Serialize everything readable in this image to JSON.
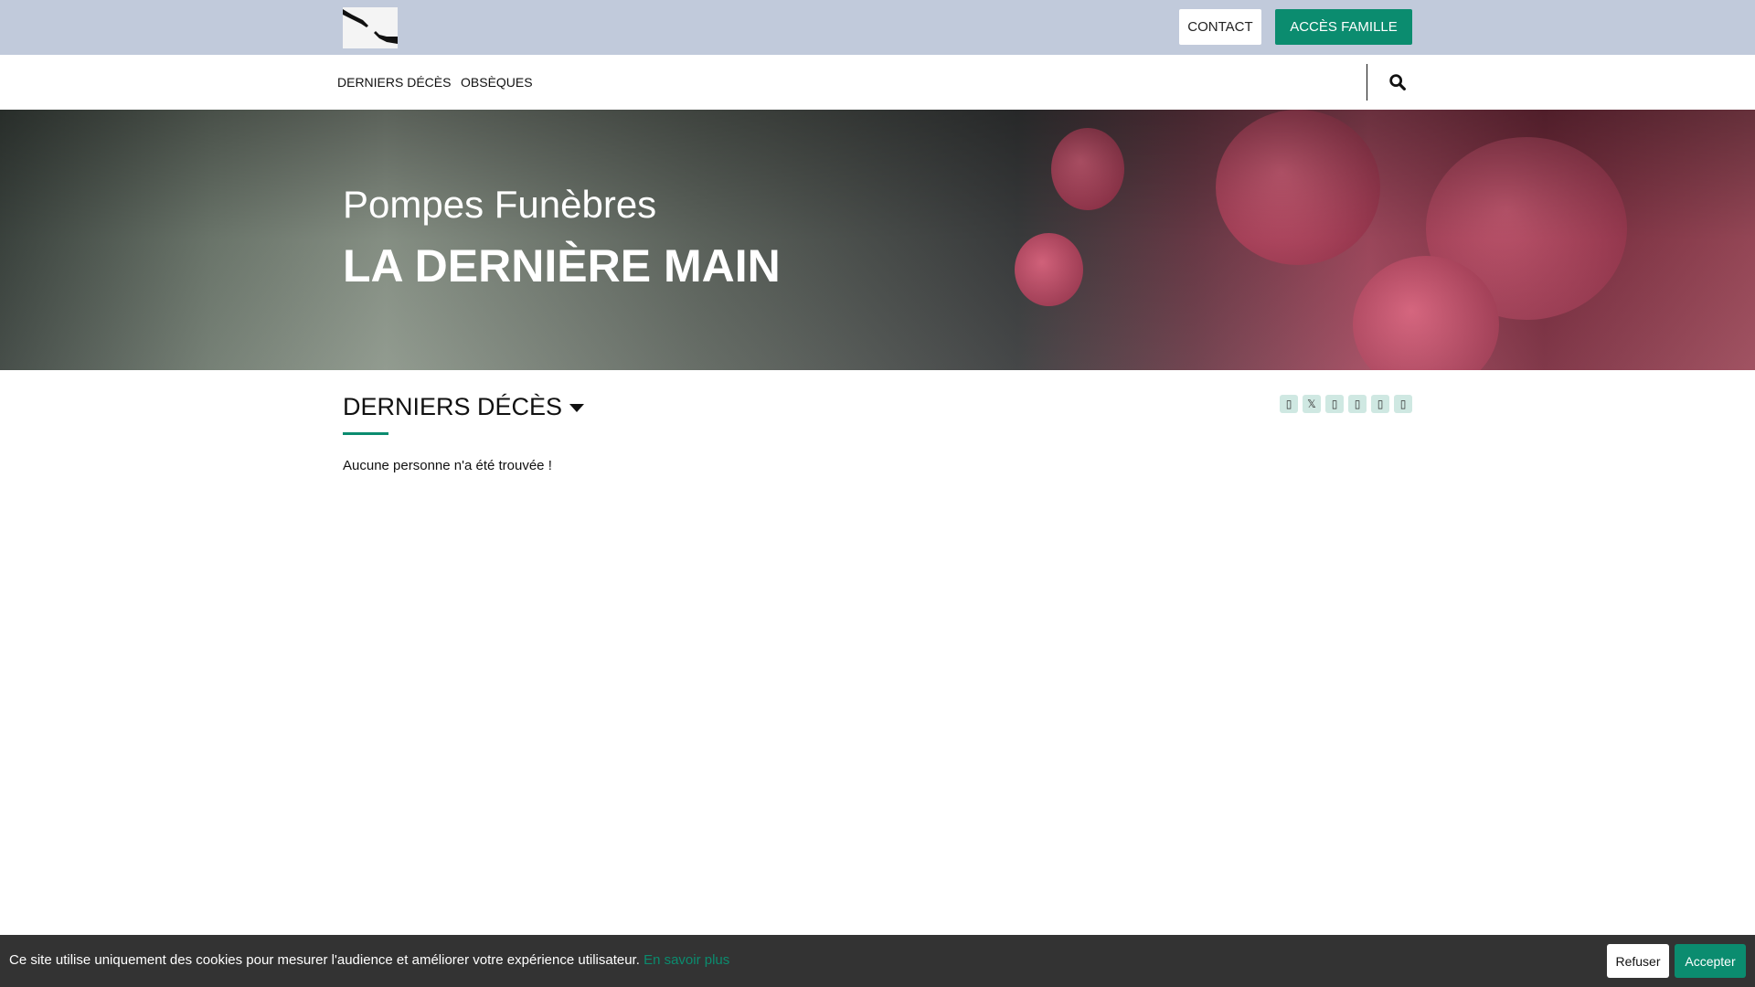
{
  "header": {
    "contact_label": "CONTACT",
    "famille_label": "ACCÈS FAMILLE"
  },
  "nav": {
    "items": [
      {
        "label": "DERNIERS DÉCÈS"
      },
      {
        "label": "OBSÈQUES"
      }
    ]
  },
  "hero": {
    "subtitle": "Pompes Funèbres",
    "title": "LA DERNIÈRE MAIN"
  },
  "section": {
    "title": "DERNIERS DÉCÈS",
    "empty_message": "Aucune personne n'a été trouvée !"
  },
  "social": {
    "icons": [
      "facebook-icon",
      "x-icon",
      "linkedin-icon",
      "whatsapp-icon",
      "email-icon",
      "print-icon"
    ],
    "x_glyph": "𝕏",
    "box_glyph": "▯"
  },
  "cookie": {
    "message": "Ce site utilise uniquement des cookies pour mesurer l'audience et améliorer votre expérience utilisateur.",
    "link": "En savoir plus",
    "refuse": "Refuser",
    "accept": "Accepter"
  },
  "colors": {
    "accent": "#0b8c6f",
    "topbar": "#c1cadb",
    "cookie_bg": "#333333"
  }
}
